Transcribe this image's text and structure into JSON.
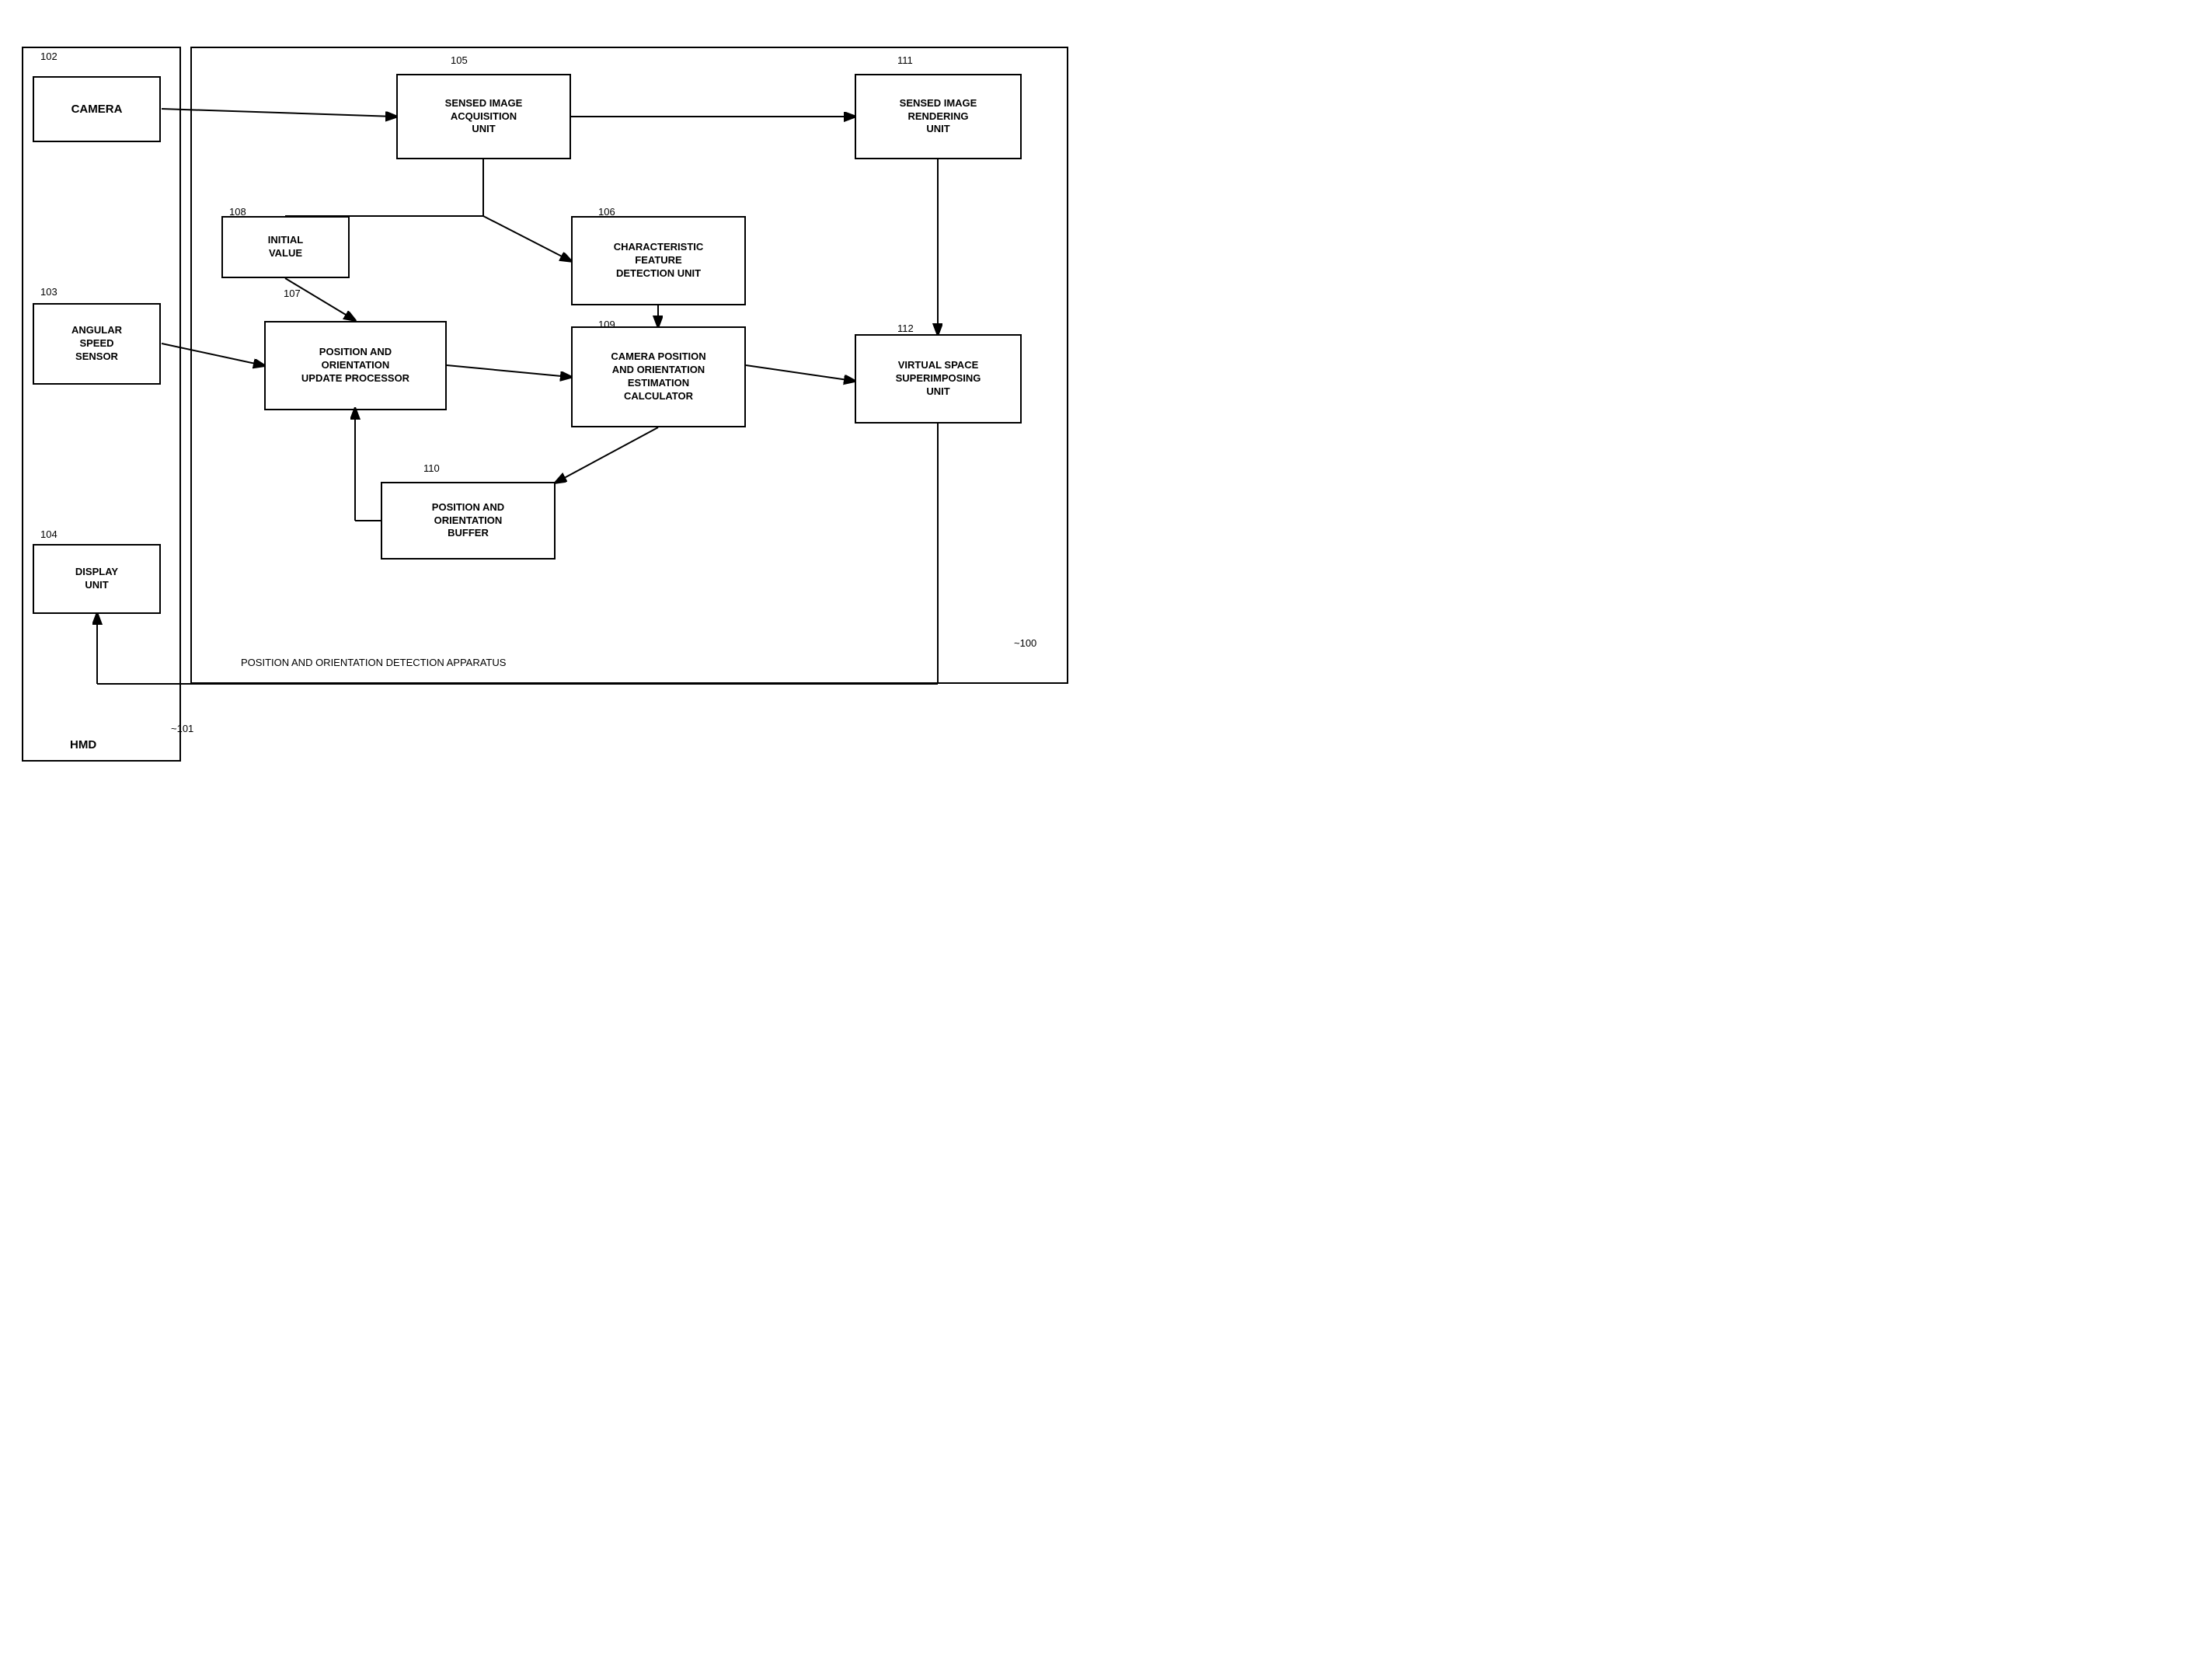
{
  "blocks": {
    "camera": {
      "label": "CAMERA",
      "id": "102"
    },
    "angular_speed": {
      "label": "ANGULAR\nSPEED\nSENSOR",
      "id": "103"
    },
    "display": {
      "label": "DISPLAY\nUNIT",
      "id": "104"
    },
    "sensed_acquisition": {
      "label": "SENSED IMAGE\nACQUISITION\nUNIT",
      "id": "105"
    },
    "char_feature": {
      "label": "CHARACTERISTIC\nFEATURE\nDETECTION UNIT",
      "id": "106"
    },
    "pos_orient_update": {
      "label": "POSITION AND\nORIENTATION\nUPDATE PROCESSOR",
      "id": "107"
    },
    "initial_value": {
      "label": "INITIAL\nVALUE",
      "id": "108"
    },
    "cam_pos_orient": {
      "label": "CAMERA POSITION\nAND ORIENTATION\nESTIMATION\nCALCULATOR",
      "id": "109"
    },
    "pos_orient_buffer": {
      "label": "POSITION AND\nORIENTATION\nBUFFER",
      "id": "110"
    },
    "sensed_rendering": {
      "label": "SENSED IMAGE\nRENDERING\nUNIT",
      "id": "111"
    },
    "virtual_space": {
      "label": "VIRTUAL SPACE\nSUPERIMPOSING\nUNIT",
      "id": "112"
    }
  },
  "labels": {
    "hmd": "HMD",
    "apparatus": "POSITION AND ORIENTATION DETECTION APPARATUS",
    "outer_ref": "100",
    "hmd_ref": "101"
  }
}
